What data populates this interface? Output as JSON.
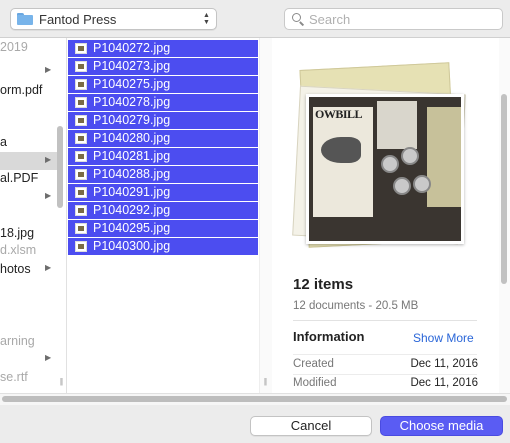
{
  "toolbar": {
    "location": "Fantod Press",
    "search_placeholder": "Search"
  },
  "left_column": {
    "items": [
      {
        "label": "2019",
        "dim": true
      },
      {
        "label": "",
        "chevron": true
      },
      {
        "label": "orm.pdf"
      },
      {
        "label": ""
      },
      {
        "label": "a"
      },
      {
        "label": "",
        "chevron": true
      },
      {
        "label": "al.PDF"
      },
      {
        "label": "",
        "chevron": true
      },
      {
        "label": "18.jpg"
      },
      {
        "label": "d.xlsm",
        "dim": true
      },
      {
        "label": "hotos",
        "chevron": true
      },
      {
        "label": ""
      },
      {
        "label": "arning",
        "dim": true
      },
      {
        "label": "",
        "chevron": true
      },
      {
        "label": "se.rtf",
        "dim": true
      }
    ]
  },
  "files": [
    "P1040272.jpg",
    "P1040273.jpg",
    "P1040275.jpg",
    "P1040278.jpg",
    "P1040279.jpg",
    "P1040280.jpg",
    "P1040281.jpg",
    "P1040288.jpg",
    "P1040291.jpg",
    "P1040292.jpg",
    "P1040295.jpg",
    "P1040300.jpg"
  ],
  "preview": {
    "photo_text": "OWBILL",
    "title": "12 items",
    "subtitle": "12 documents - 20.5 MB",
    "info_heading": "Information",
    "show_more": "Show More",
    "rows": [
      {
        "label": "Created",
        "value": "Dec 11, 2016"
      },
      {
        "label": "Modified",
        "value": "Dec 11, 2016"
      }
    ]
  },
  "buttons": {
    "cancel": "Cancel",
    "choose": "Choose media"
  },
  "colors": {
    "selection": "#4c4df0",
    "primary_button": "#5a5cf3",
    "link": "#2a66d8"
  }
}
